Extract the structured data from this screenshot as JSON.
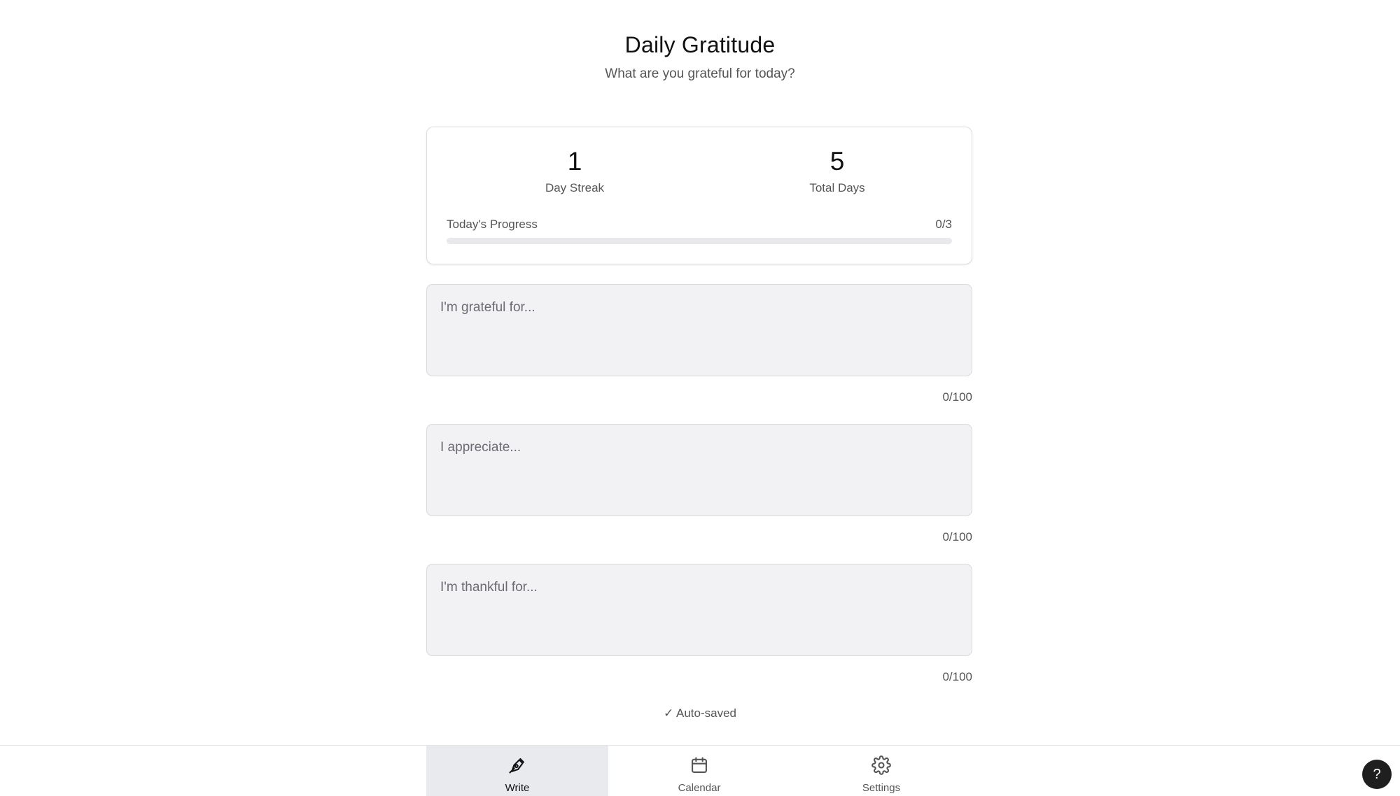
{
  "header": {
    "title": "Daily Gratitude",
    "subtitle": "What are you grateful for today?"
  },
  "stats": {
    "streak_value": "1",
    "streak_label": "Day Streak",
    "total_value": "5",
    "total_label": "Total Days",
    "progress_label": "Today's Progress",
    "progress_text": "0/3",
    "progress_fraction": 0
  },
  "entries": [
    {
      "value": "",
      "placeholder": "I'm grateful for...",
      "counter": "0/100"
    },
    {
      "value": "",
      "placeholder": "I appreciate...",
      "counter": "0/100"
    },
    {
      "value": "",
      "placeholder": "I'm thankful for...",
      "counter": "0/100"
    }
  ],
  "autosave_text": "✓ Auto-saved",
  "nav": {
    "items": [
      {
        "label": "Write",
        "icon": "pen-icon",
        "active": true
      },
      {
        "label": "Calendar",
        "icon": "calendar-icon",
        "active": false
      },
      {
        "label": "Settings",
        "icon": "gear-icon",
        "active": false
      }
    ]
  },
  "help_label": "?"
}
